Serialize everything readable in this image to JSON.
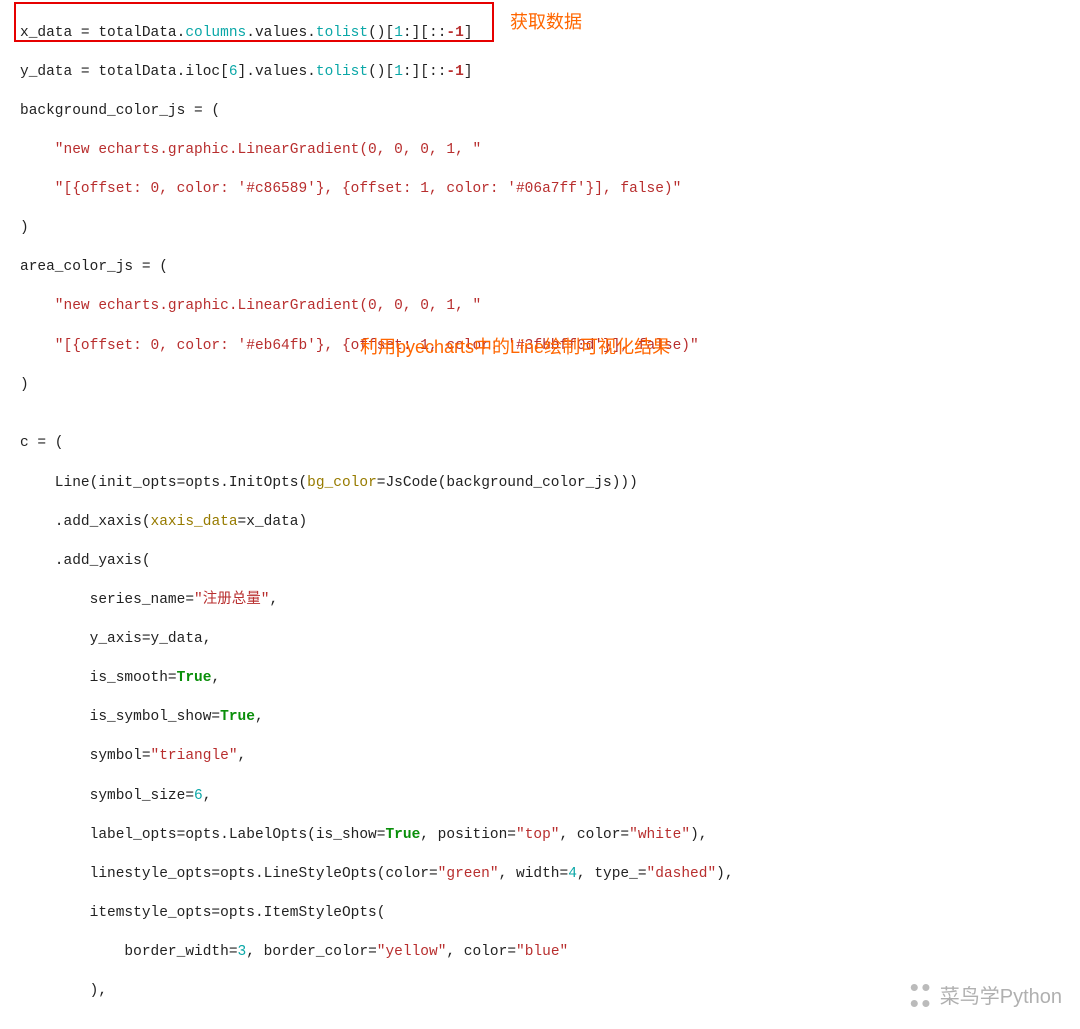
{
  "annotations": {
    "get_data": "获取数据",
    "use_pyecharts": "利用pyecharts中的Line绘制可视化结果"
  },
  "watermark": "菜鸟学Python",
  "code": {
    "l1_pre": "x_data = totalData.",
    "l1_teal1": "columns",
    "l1_mid1": ".values.",
    "l1_teal2": "tolist",
    "l1_mid2": "()[",
    "l1_teal3": "1",
    "l1_mid3": ":][::",
    "l1_neg": "-1",
    "l1_end": "]",
    "l2_pre": "y_data = totalData.iloc[",
    "l2_num6": "6",
    "l2_mid1": "].values.",
    "l2_teal1": "tolist",
    "l2_mid2": "()[",
    "l2_num1": "1",
    "l2_mid3": ":][::",
    "l2_neg": "-1",
    "l2_end": "]",
    "l3": "background_color_js = (",
    "l4": "    \"new echarts.graphic.LinearGradient(0, 0, 0, 1, \"",
    "l5": "    \"[{offset: 0, color: '#c86589'}, {offset: 1, color: '#06a7ff'}], false)\"",
    "l6": ")",
    "l7": "area_color_js = (",
    "l8": "    \"new echarts.graphic.LinearGradient(0, 0, 0, 1, \"",
    "l9": "    \"[{offset: 0, color: '#eb64fb'}, {offset: 1, color: '#3fbbff0d'}], false)\"",
    "l10": ")",
    "l11": "",
    "l12": "c = (",
    "l13_a": "    Line(init_opts=opts.InitOpts(",
    "l13_b": "bg_color",
    "l13_c": "=JsCode(background_color_js)))",
    "l14_a": "    .add_xaxis(",
    "l14_b": "xaxis_data",
    "l14_c": "=x_data)",
    "l15": "    .add_yaxis(",
    "l16_a": "        series_name=",
    "l16_b": "\"注册总量\"",
    "l16_c": ",",
    "l17": "        y_axis=y_data,",
    "l18_a": "        is_smooth=",
    "l18_b": "True",
    "l18_c": ",",
    "l19_a": "        is_symbol_show=",
    "l19_b": "True",
    "l19_c": ",",
    "l20_a": "        symbol=",
    "l20_b": "\"triangle\"",
    "l20_c": ",",
    "l21_a": "        symbol_size=",
    "l21_b": "6",
    "l21_c": ",",
    "l22_a": "        label_opts=opts.LabelOpts(is_show=",
    "l22_b": "True",
    "l22_c": ", position=",
    "l22_d": "\"top\"",
    "l22_e": ", color=",
    "l22_f": "\"white\"",
    "l22_g": "),",
    "l23_a": "        linestyle_opts=opts.LineStyleOpts(color=",
    "l23_b": "\"green\"",
    "l23_c": ", width=",
    "l23_d": "4",
    "l23_e": ", type_=",
    "l23_f": "\"dashed\"",
    "l23_g": "),",
    "l24": "        itemstyle_opts=opts.ItemStyleOpts(",
    "l25_a": "            border_width=",
    "l25_b": "3",
    "l25_c": ", border_color=",
    "l25_d": "\"yellow\"",
    "l25_e": ", color=",
    "l25_f": "\"blue\"",
    "l26": "        ),"
  }
}
